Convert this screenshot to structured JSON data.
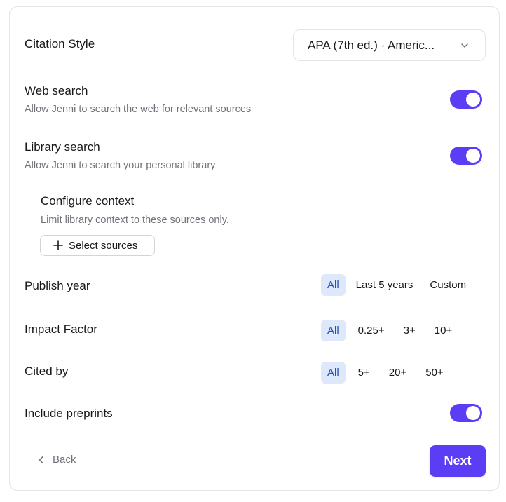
{
  "citation": {
    "label": "Citation Style",
    "value": "APA (7th ed.) · Americ..."
  },
  "web_search": {
    "label": "Web search",
    "description": "Allow Jenni to search the web for relevant sources",
    "enabled": true
  },
  "library_search": {
    "label": "Library search",
    "description": "Allow Jenni to search your personal library",
    "enabled": true
  },
  "configure_context": {
    "title": "Configure context",
    "description": "Limit library context to these sources only.",
    "button_label": "Select sources"
  },
  "publish_year": {
    "label": "Publish year",
    "options": [
      "All",
      "Last 5 years",
      "Custom"
    ],
    "selected": "All"
  },
  "impact_factor": {
    "label": "Impact Factor",
    "options": [
      "All",
      "0.25+",
      "3+",
      "10+"
    ],
    "selected": "All"
  },
  "cited_by": {
    "label": "Cited by",
    "options": [
      "All",
      "5+",
      "20+",
      "50+"
    ],
    "selected": "All"
  },
  "include_preprints": {
    "label": "Include preprints",
    "enabled": true
  },
  "footer": {
    "back_label": "Back",
    "next_label": "Next"
  },
  "colors": {
    "accent": "#5b3df5",
    "selected_pill_bg": "#dde8fb",
    "selected_pill_text": "#1e4fb5"
  }
}
